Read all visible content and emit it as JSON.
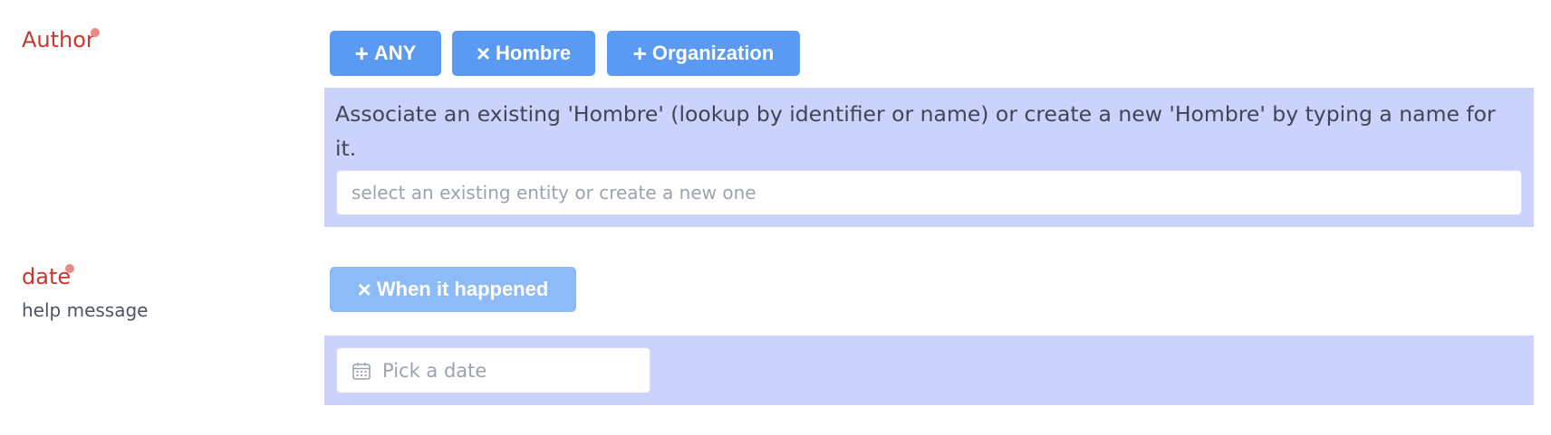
{
  "author_field": {
    "label": "Author",
    "buttons": [
      {
        "glyph": "+",
        "label": "ANY",
        "icon": "plus-icon"
      },
      {
        "glyph": "×",
        "label": "Hombre",
        "icon": "close-icon"
      },
      {
        "glyph": "+",
        "label": "Organization",
        "icon": "plus-icon"
      }
    ],
    "description": "Associate an existing 'Hombre' (lookup by identifier or name) or create a new 'Hombre' by typing a name for it.",
    "input": {
      "value": "",
      "placeholder": "select an existing entity or create a new one"
    }
  },
  "date_field": {
    "label": "date",
    "help": "help message",
    "button": {
      "glyph": "×",
      "label": "When it happened",
      "icon": "close-icon"
    },
    "input": {
      "value": "",
      "placeholder": "Pick a date",
      "icon": "calendar-icon"
    }
  },
  "colors": {
    "label_required": "#c8372d",
    "required_dot": "#ea8a85",
    "button": "#5a9af2",
    "button_disabled": "#8dbbf8",
    "panel": "#cbd2fb"
  }
}
